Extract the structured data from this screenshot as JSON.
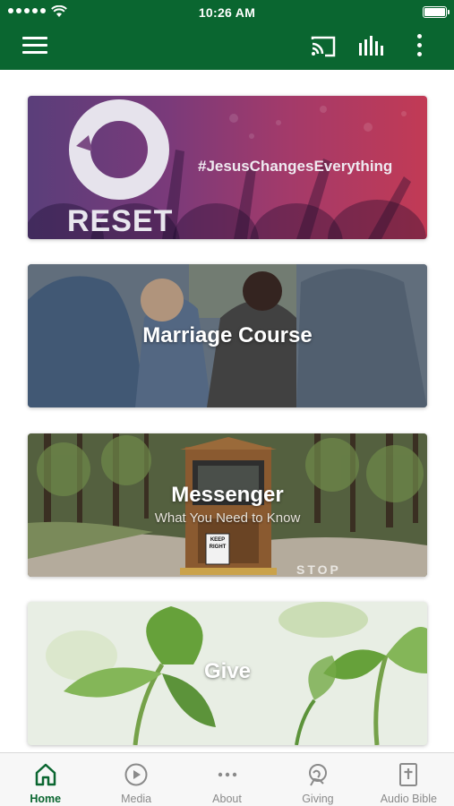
{
  "status_bar": {
    "time": "10:26 AM"
  },
  "header": {
    "menu_icon": "hamburger-menu-icon",
    "cast_icon": "cast-icon",
    "audio_icon": "equalizer-bars-icon",
    "more_icon": "more-vertical-icon",
    "color": "#0a6630"
  },
  "cards": [
    {
      "logo_text": "RESET",
      "hashtag": "#JesusChangesEverything"
    },
    {
      "title": "Marriage Course"
    },
    {
      "title": "Messenger",
      "subtitle": "What You Need to Know",
      "sign_text": "KEEP RIGHT",
      "road_text": "STOP"
    },
    {
      "title": "Give"
    }
  ],
  "tabs": [
    {
      "label": "Home",
      "icon": "home-icon",
      "active": true
    },
    {
      "label": "Media",
      "icon": "play-circle-icon",
      "active": false
    },
    {
      "label": "About",
      "icon": "more-horizontal-icon",
      "active": false
    },
    {
      "label": "Giving",
      "icon": "giving-hand-icon",
      "active": false
    },
    {
      "label": "Audio Bible",
      "icon": "bible-icon",
      "active": false
    }
  ],
  "colors": {
    "accent": "#0a6630",
    "inactive_tab": "#8a8a8a"
  }
}
